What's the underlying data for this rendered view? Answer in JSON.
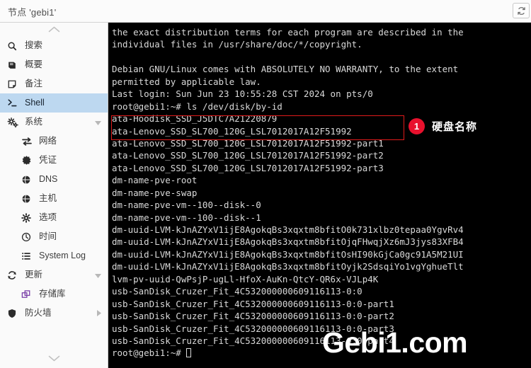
{
  "window": {
    "title": "节点 'gebi1'",
    "reload_icon": "reload-icon"
  },
  "sidebar": {
    "scroll_up_icon": "chevron-up-icon",
    "scroll_down_icon": "chevron-down-icon",
    "items": [
      {
        "label": "搜索",
        "icon": "search-icon",
        "indent": false,
        "active": false,
        "caret": ""
      },
      {
        "label": "概要",
        "icon": "book-icon",
        "indent": false,
        "active": false,
        "caret": ""
      },
      {
        "label": "备注",
        "icon": "note-icon",
        "indent": false,
        "active": false,
        "caret": ""
      },
      {
        "label": "Shell",
        "icon": "shell-icon",
        "indent": false,
        "active": true,
        "caret": ""
      },
      {
        "label": "系统",
        "icon": "gears-icon",
        "indent": false,
        "active": false,
        "caret": "down"
      },
      {
        "label": "网络",
        "icon": "network-icon",
        "indent": true,
        "active": false,
        "caret": ""
      },
      {
        "label": "凭证",
        "icon": "badge-icon",
        "indent": true,
        "active": false,
        "caret": ""
      },
      {
        "label": "DNS",
        "icon": "globe-icon",
        "indent": true,
        "active": false,
        "caret": ""
      },
      {
        "label": "主机",
        "icon": "globe-icon",
        "indent": true,
        "active": false,
        "caret": ""
      },
      {
        "label": "选项",
        "icon": "gear-icon",
        "indent": true,
        "active": false,
        "caret": ""
      },
      {
        "label": "时间",
        "icon": "clock-icon",
        "indent": true,
        "active": false,
        "caret": ""
      },
      {
        "label": "System Log",
        "icon": "list-icon",
        "indent": true,
        "active": false,
        "caret": ""
      },
      {
        "label": "更新",
        "icon": "refresh-icon",
        "indent": false,
        "active": false,
        "caret": "down"
      },
      {
        "label": "存储库",
        "icon": "repo-icon",
        "indent": true,
        "active": false,
        "caret": ""
      },
      {
        "label": "防火墙",
        "icon": "shield-icon",
        "indent": false,
        "active": false,
        "caret": "right"
      }
    ]
  },
  "terminal": {
    "lines": [
      "the exact distribution terms for each program are described in the",
      "individual files in /usr/share/doc/*/copyright.",
      "",
      "Debian GNU/Linux comes with ABSOLUTELY NO WARRANTY, to the extent",
      "permitted by applicable law.",
      "Last login: Sun Jun 23 10:55:28 CST 2024 on pts/0",
      "root@gebi1:~# ls /dev/disk/by-id",
      "ata-Hoodisk_SSD_J5DTC7A21220879",
      "ata-Lenovo_SSD_SL700_120G_LSL7012017A12F51992",
      "ata-Lenovo_SSD_SL700_120G_LSL7012017A12F51992-part1",
      "ata-Lenovo_SSD_SL700_120G_LSL7012017A12F51992-part2",
      "ata-Lenovo_SSD_SL700_120G_LSL7012017A12F51992-part3",
      "dm-name-pve-root",
      "dm-name-pve-swap",
      "dm-name-pve-vm--100--disk--0",
      "dm-name-pve-vm--100--disk--1",
      "dm-uuid-LVM-kJnAZYxV1ijE8AgokqBs3xqxtm8bfitO0k731xlbz0tepaa0YgvRv4",
      "dm-uuid-LVM-kJnAZYxV1ijE8AgokqBs3xqxtm8bfitOjqFHwqjXz6mJ3jys83XFB4",
      "dm-uuid-LVM-kJnAZYxV1ijE8AgokqBs3xqxtm8bfitOsHI90kGjCa0gc91A5M21UI",
      "dm-uuid-LVM-kJnAZYxV1ijE8AgokqBs3xqxtm8bfitOyjk2SdsqiYo1vgYghueTlt",
      "lvm-pv-uuid-QwPsjP-ugLl-HfoX-AuKn-QtcY-QR6x-VJLp4K",
      "usb-SanDisk_Cruzer_Fit_4C532000000609116113-0:0",
      "usb-SanDisk_Cruzer_Fit_4C532000000609116113-0:0-part1",
      "usb-SanDisk_Cruzer_Fit_4C532000000609116113-0:0-part2",
      "usb-SanDisk_Cruzer_Fit_4C532000000609116113-0:0-part3",
      "usb-SanDisk_Cruzer_Fit_4C532000000609116113-0:0-part4"
    ],
    "prompt": "root@gebi1:~#"
  },
  "annotation": {
    "badge_number": "1",
    "text": "硬盘名称",
    "box_color": "#e01b1b",
    "badge_color": "#e8112d"
  },
  "watermark": {
    "text": "Gebi1.com"
  }
}
